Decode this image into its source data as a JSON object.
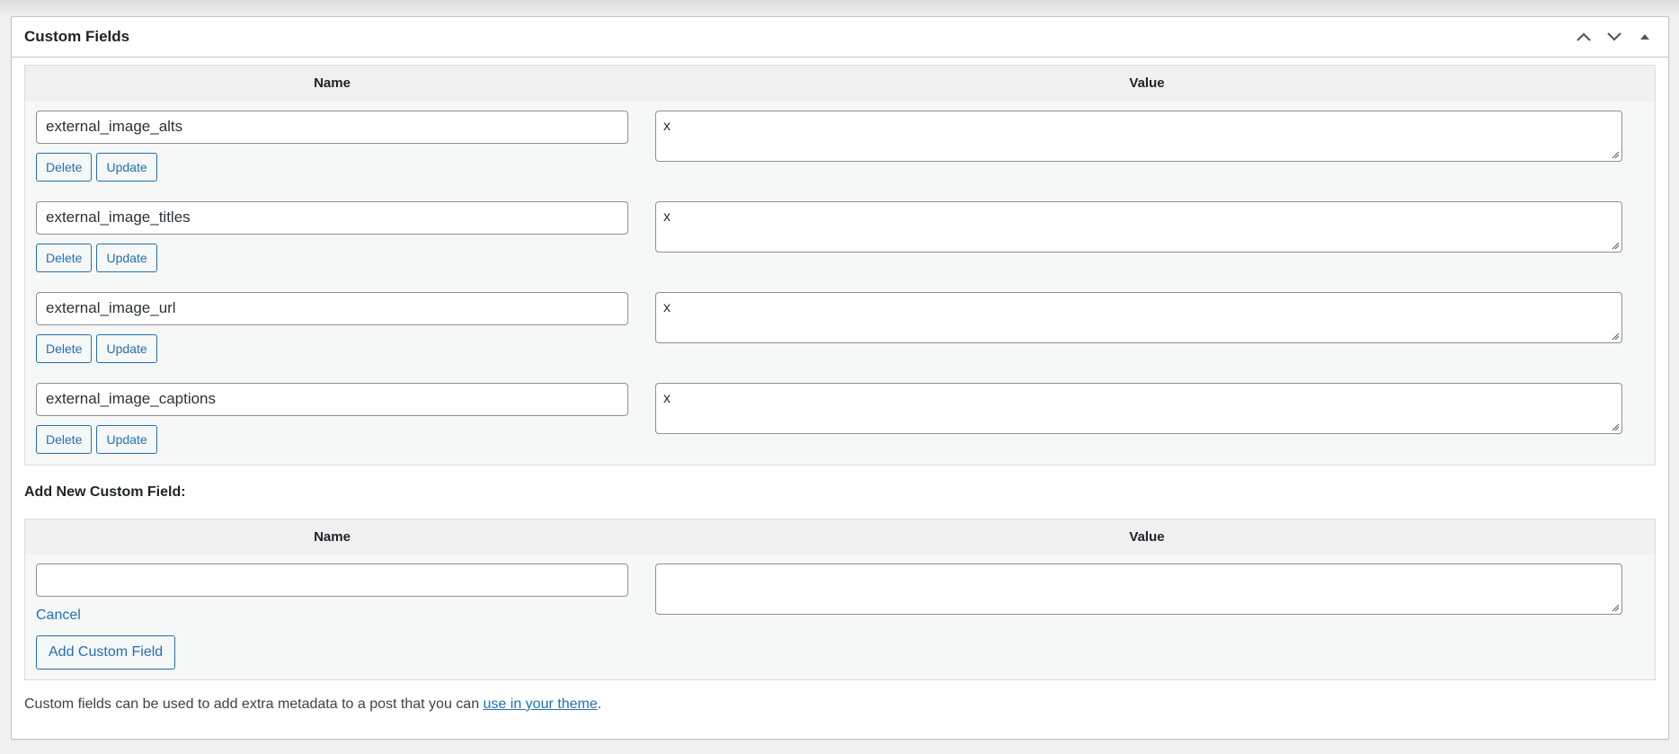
{
  "panel": {
    "title": "Custom Fields",
    "controls": [
      {
        "name": "move-up-icon"
      },
      {
        "name": "move-down-icon"
      },
      {
        "name": "toggle-panel-icon"
      }
    ]
  },
  "existing_table": {
    "headers": {
      "name": "Name",
      "value": "Value"
    },
    "rows": [
      {
        "key": "external_image_alts",
        "value": "x",
        "delete_label": "Delete",
        "update_label": "Update"
      },
      {
        "key": "external_image_titles",
        "value": "x",
        "delete_label": "Delete",
        "update_label": "Update"
      },
      {
        "key": "external_image_url",
        "value": "x",
        "delete_label": "Delete",
        "update_label": "Update"
      },
      {
        "key": "external_image_captions",
        "value": "x",
        "delete_label": "Delete",
        "update_label": "Update"
      }
    ]
  },
  "new_field": {
    "label": "Add New Custom Field:",
    "headers": {
      "name": "Name",
      "value": "Value"
    },
    "name_value": "",
    "value_value": "",
    "cancel_label": "Cancel",
    "add_button_label": "Add Custom Field"
  },
  "footer": {
    "text_before": "Custom fields can be used to add extra metadata to a post that you can ",
    "link_text": "use in your theme",
    "text_after": "."
  },
  "colors": {
    "accent": "#2271b1",
    "border": "#c3c4c7",
    "table_bg": "#f6f7f7",
    "header_bg": "#f0f0f1"
  }
}
